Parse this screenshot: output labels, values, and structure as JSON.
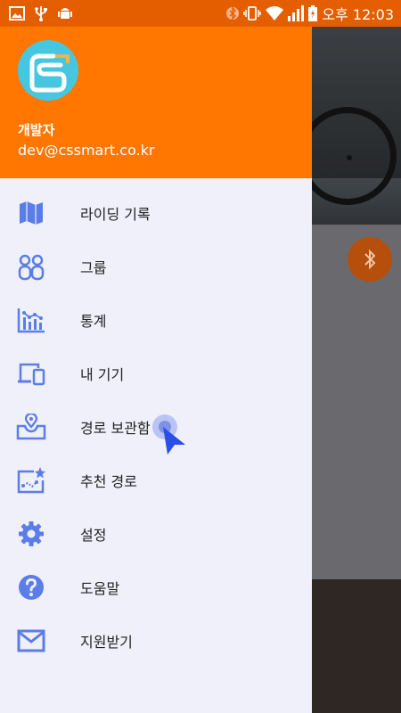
{
  "status_bar": {
    "time": "오후 12:03",
    "icons": [
      "image-icon",
      "usb-icon",
      "android-debug-icon",
      "bluetooth-icon",
      "vibrate-icon",
      "wifi-icon",
      "signal-icon",
      "battery-charging-icon"
    ]
  },
  "drawer": {
    "header": {
      "name": "개발자",
      "email": "dev@cssmart.co.kr",
      "avatar_icon": "cs-logo-icon"
    },
    "items": [
      {
        "label": "라이딩 기록",
        "icon": "map-icon"
      },
      {
        "label": "그룹",
        "icon": "group-icon"
      },
      {
        "label": "통계",
        "icon": "chart-icon"
      },
      {
        "label": "내 기기",
        "icon": "devices-icon"
      },
      {
        "label": "경로 보관함",
        "icon": "route-inbox-icon"
      },
      {
        "label": "추천 경로",
        "icon": "recommended-route-icon"
      },
      {
        "label": "설정",
        "icon": "gear-icon"
      },
      {
        "label": "도움말",
        "icon": "help-icon"
      },
      {
        "label": "지원받기",
        "icon": "mail-icon"
      }
    ]
  },
  "colors": {
    "status_bar": "#e45e00",
    "header": "#ff7600",
    "drawer_bg": "#eff0fa",
    "icon": "#5b7de8",
    "fab": "#b54f0b"
  },
  "background": {
    "fab_icon": "bluetooth-icon"
  }
}
